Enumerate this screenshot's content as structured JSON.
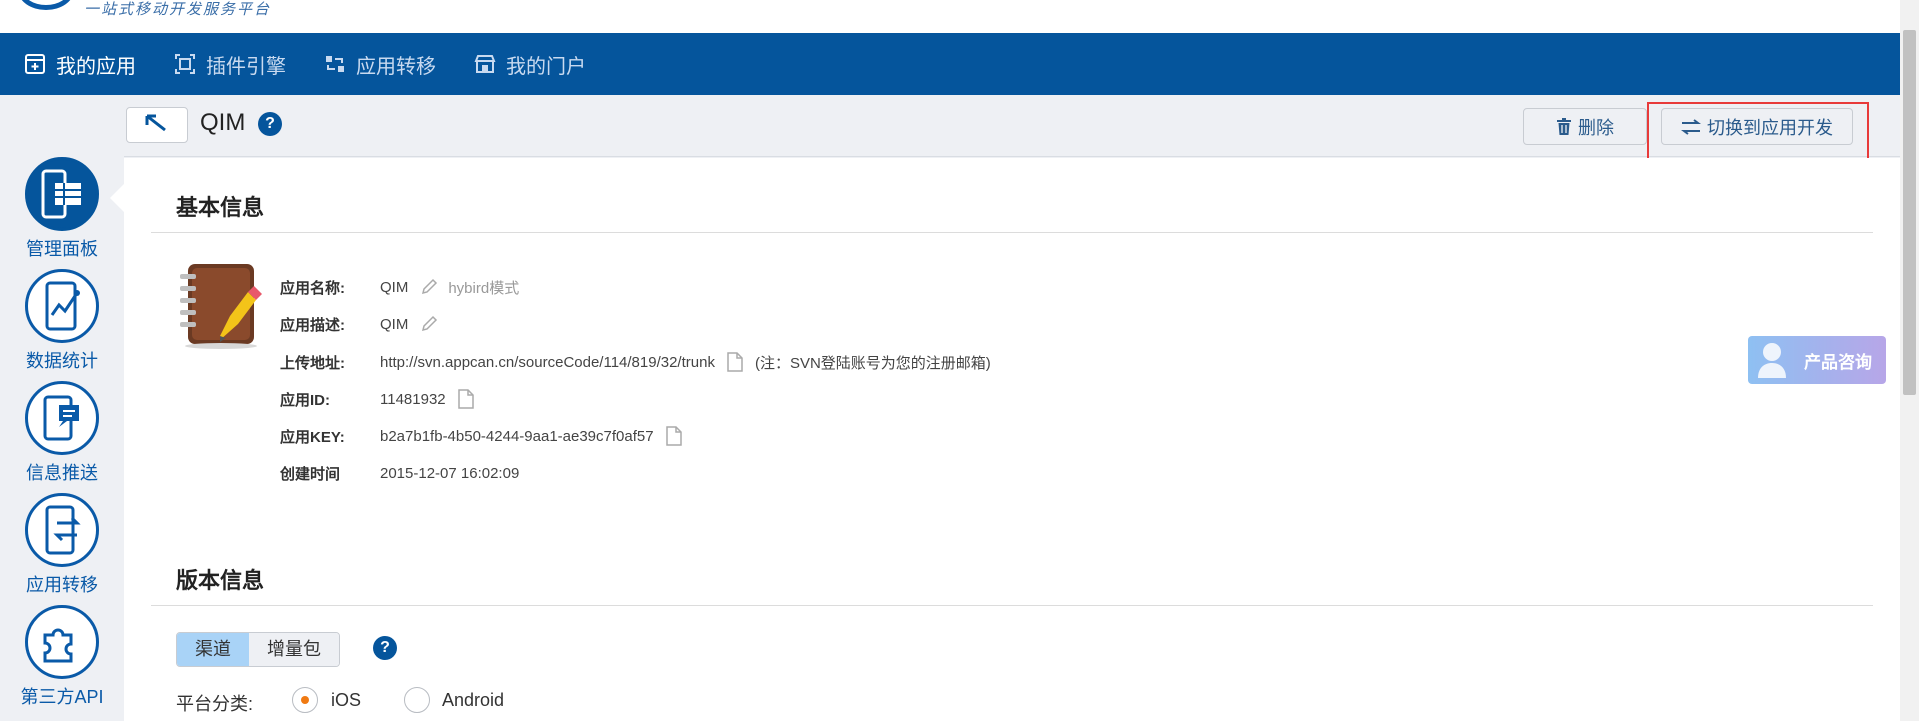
{
  "brand": {
    "tagline": "一站式移动开发服务平台"
  },
  "nav": {
    "items": [
      {
        "label": "我的应用",
        "icon": "app-box-icon",
        "active": true
      },
      {
        "label": "插件引擎",
        "icon": "plugin-frame-icon",
        "active": false
      },
      {
        "label": "应用转移",
        "icon": "transfer-icon",
        "active": false
      },
      {
        "label": "我的门户",
        "icon": "store-icon",
        "active": false
      }
    ]
  },
  "sidebar": {
    "items": [
      {
        "label": "管理面板",
        "icon": "phone-grid-icon",
        "active": true
      },
      {
        "label": "数据统计",
        "icon": "phone-chart-icon",
        "active": false
      },
      {
        "label": "信息推送",
        "icon": "phone-push-icon",
        "active": false
      },
      {
        "label": "应用转移",
        "icon": "phone-transfer-icon",
        "active": false
      },
      {
        "label": "第三方API",
        "icon": "puzzle-icon",
        "active": false
      }
    ]
  },
  "header": {
    "app_name": "QIM",
    "help": "?",
    "delete_label": "删除",
    "switch_label": "切换到应用开发"
  },
  "basic_info": {
    "title": "基本信息",
    "rows": {
      "name": {
        "key": "应用名称:",
        "value": "QIM",
        "extra": "hybird模式"
      },
      "desc": {
        "key": "应用描述:",
        "value": "QIM"
      },
      "upload": {
        "key": "上传地址:",
        "value": "http://svn.appcan.cn/sourceCode/114/819/32/trunk",
        "note": "(注：SVN登陆账号为您的注册邮箱)"
      },
      "id": {
        "key": "应用ID:",
        "value": "11481932"
      },
      "key": {
        "key": "应用KEY:",
        "value": "b2a7b1fb-4b50-4244-9aa1-ae39c7f0af57"
      },
      "created": {
        "key": "创建时间",
        "value": "2015-12-07 16:02:09"
      }
    }
  },
  "version_info": {
    "title": "版本信息",
    "tabs": [
      "渠道",
      "增量包"
    ],
    "active_tab": 0,
    "platform_label": "平台分类:",
    "platforms": [
      {
        "label": "iOS",
        "checked": true
      },
      {
        "label": "Android",
        "checked": false
      }
    ]
  },
  "consult": {
    "label": "产品咨询"
  },
  "colors": {
    "nav_bg": "#05559c",
    "accent": "#0a5aa8",
    "highlight_box": "#e83a3a",
    "radio_checked": "#f07a12"
  }
}
